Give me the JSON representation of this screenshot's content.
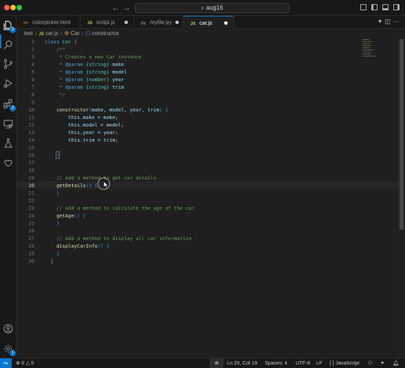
{
  "titlebar": {
    "search": "aug16",
    "back_icon": "arrow-left-icon",
    "forward_icon": "arrow-right-icon"
  },
  "activity_bar": {
    "items": [
      {
        "name": "explorer",
        "badge": "3"
      },
      {
        "name": "search",
        "badge": ""
      },
      {
        "name": "source-control",
        "badge": ""
      },
      {
        "name": "run-debug",
        "badge": ""
      },
      {
        "name": "extensions",
        "badge": "2"
      },
      {
        "name": "remote-explorer",
        "badge": ""
      },
      {
        "name": "testing",
        "badge": ""
      },
      {
        "name": "copilot",
        "badge": ""
      }
    ],
    "accounts_icon": "account-icon",
    "settings_badge": "1"
  },
  "tabs": [
    {
      "label": "colorpicker.html",
      "icon": "<>",
      "dirty": false,
      "active": false
    },
    {
      "label": "script.js",
      "icon": "JS",
      "dirty": true,
      "active": false
    },
    {
      "label": "myfile.py",
      "icon": "py",
      "dirty": true,
      "active": false
    },
    {
      "label": "car.js",
      "icon": "JS",
      "dirty": true,
      "active": true
    }
  ],
  "breadcrumbs": {
    "folder": "test",
    "file": "car.js",
    "file_icon": "JS",
    "class": "Car",
    "method": "constructor"
  },
  "editor": {
    "current_line": 20,
    "line_numbers": [
      "1",
      "2",
      "3",
      "4",
      "5",
      "6",
      "7",
      "8",
      "9",
      "10",
      "11",
      "12",
      "13",
      "14",
      "15",
      "16",
      "17",
      "18",
      "19",
      "20",
      "21",
      "22",
      "23",
      "24",
      "25",
      "26",
      "27",
      "28",
      "29",
      "30"
    ],
    "code": {
      "l1_kw": "class",
      "l1_name": "Car",
      "l1_brace": "{",
      "l2": "/**",
      "l3": "* Creates a new Car instance",
      "l4_tag": "@param",
      "l4_type": "{string}",
      "l4_name": "make",
      "l5_tag": "@param",
      "l5_type": "{string}",
      "l5_name": "model",
      "l6_tag": "@param",
      "l6_type": "{number}",
      "l6_name": "year",
      "l7_tag": "@param",
      "l7_type": "{string}",
      "l7_name": "trim",
      "l8": "*/",
      "l10_fn": "constructor",
      "l10_params": "make, model, year, trim",
      "l10_brace": "{",
      "l11": "this.make = make;",
      "l12": "this.model = model;",
      "l13": "this.year = year;",
      "l14": "this.trim = trim;",
      "l16_brace": "}",
      "l19": "// Add a method to get car details",
      "l20_fn": "getDetails",
      "l20_rest": "() {",
      "l21": "}",
      "l23": "// Add a method to calculate the age of the car",
      "l24_fn": "getAge",
      "l24_rest": "() {",
      "l25": "}",
      "l27": "// Add a method to display all car information",
      "l28_fn": "displayCarInfo",
      "l28_rest": "() {",
      "l29": "}",
      "l30": "}"
    }
  },
  "status_bar": {
    "errors": "0",
    "warnings": "0",
    "position": "Ln 20, Col 19",
    "spaces": "Spaces: 4",
    "encoding": "UTF-8",
    "eol": "LF",
    "language": "JavaScript"
  },
  "colors": {
    "accent": "#0078d4",
    "background": "#1f1f1f"
  }
}
